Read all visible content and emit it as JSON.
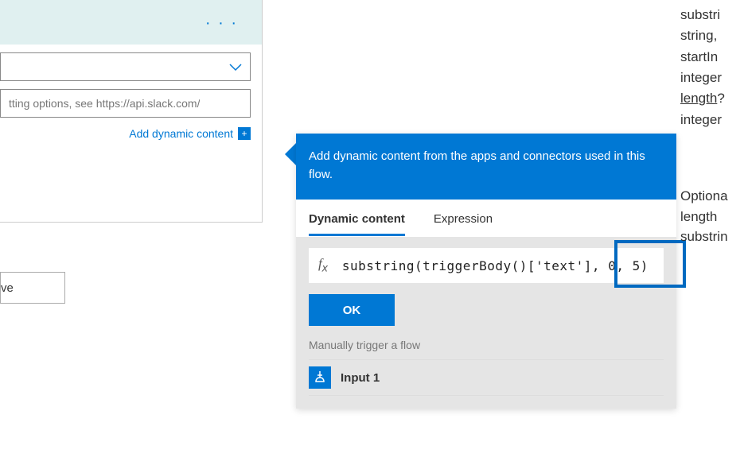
{
  "left": {
    "placeholder": "tting options, see https://api.slack.com/",
    "add_dynamic": "Add dynamic content"
  },
  "save_label": "ve",
  "flyout": {
    "header": "Add dynamic content from the apps and connectors used in this flow.",
    "tabs": {
      "dynamic": "Dynamic content",
      "expression": "Expression"
    },
    "expr": "substring(triggerBody()['text'], 0, 5)",
    "ok": "OK",
    "section": "Manually trigger a flow",
    "item1": "Input 1"
  },
  "doc": {
    "l1": "substri",
    "l2": "string,",
    "l3": "startIn",
    "l4": "integer",
    "l5": "length",
    "l5b": "?",
    "l6": "integer",
    "p1": "Optiona",
    "p2": "length",
    "p3": "substrin"
  }
}
